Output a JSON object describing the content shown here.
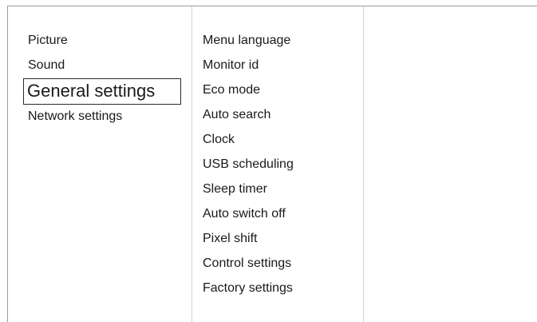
{
  "main_menu": {
    "items": [
      {
        "label": "Picture"
      },
      {
        "label": "Sound"
      },
      {
        "label": "General settings",
        "selected": true
      },
      {
        "label": "Network settings"
      }
    ]
  },
  "sub_menu": {
    "items": [
      {
        "label": "Menu language"
      },
      {
        "label": "Monitor id"
      },
      {
        "label": "Eco mode"
      },
      {
        "label": "Auto search"
      },
      {
        "label": "Clock"
      },
      {
        "label": "USB scheduling"
      },
      {
        "label": "Sleep timer"
      },
      {
        "label": "Auto switch off"
      },
      {
        "label": "Pixel shift"
      },
      {
        "label": "Control settings"
      },
      {
        "label": "Factory settings"
      }
    ]
  },
  "colors": {
    "background": "#ffffff",
    "text": "#1a1a1a",
    "selection_border": "#2a2a2a",
    "divider": "#cfcfcf"
  }
}
